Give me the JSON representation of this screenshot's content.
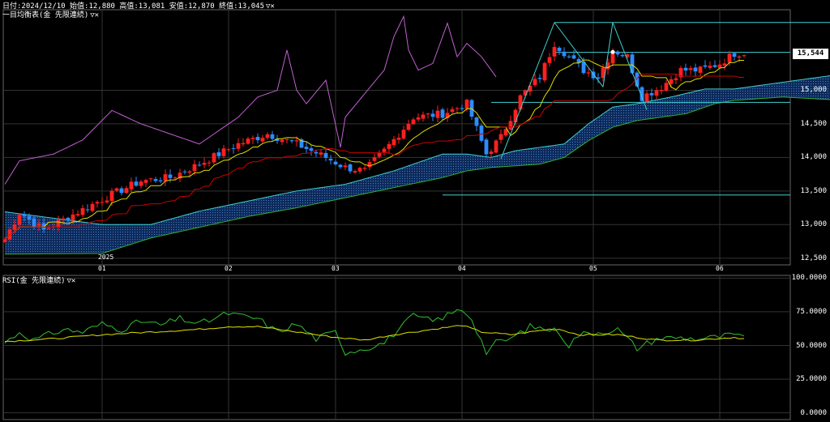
{
  "header": {
    "ohlc_text": "日付:2024/12/10 始值:12,880 高值:13,081 安值:12,870 終值:13,045",
    "main_indicator": "一目均衡表(金 先限連続)",
    "sub_indicator": "RSI(金 先限連続)",
    "control_glyphs": "▽✕"
  },
  "colors": {
    "background": "#000000",
    "candle_up": "#ff2020",
    "candle_down": "#2e8cff",
    "tenkan": "#e0e000",
    "kijun": "#cc0000",
    "chikou": "#c060d0",
    "kumo_edge": "#40d0d0",
    "kumo_fill": "#0d2a5c",
    "trendline": "#40d0d0",
    "rsi_fast": "#30c030",
    "rsi_slow": "#e0e000",
    "grid": "#333333",
    "axis_label": "#ffffff"
  },
  "chart_data": [
    {
      "type": "candlestick",
      "title": "一目均衡表(金 先限連続)",
      "y_ticks": [
        "15,000",
        "14,500",
        "14,000",
        "13,500",
        "13,000",
        "12,500"
      ],
      "y_tick_values": [
        15000,
        14500,
        14000,
        13500,
        13000,
        12500
      ],
      "ylim": [
        12400,
        16200
      ],
      "x_ticks": [
        "01",
        "02",
        "03",
        "04",
        "05",
        "06"
      ],
      "x_tick_index": [
        20,
        46,
        68,
        94,
        121,
        147
      ],
      "year_marker": "2025",
      "year_marker_index": 20,
      "n_bars": 153,
      "last_price": "15,544",
      "last_price_value": 15544,
      "horizontal_lines": [
        15565,
        14820,
        13440
      ],
      "trendlines": [
        {
          "from": [
            102,
            13980
          ],
          "to": [
            113,
            16010
          ]
        },
        {
          "from": [
            113,
            16010
          ],
          "to": [
            123,
            15050
          ]
        },
        {
          "from": [
            123,
            15050
          ],
          "to": [
            125,
            16010
          ]
        },
        {
          "from": [
            125,
            16010
          ],
          "to": [
            132,
            14710
          ]
        },
        {
          "from": [
            113,
            16010
          ],
          "to": [
            195,
            16010
          ]
        }
      ],
      "anchors": [
        [
          0,
          12780
        ],
        [
          3,
          13180
        ],
        [
          8,
          12920
        ],
        [
          14,
          13150
        ],
        [
          22,
          13450
        ],
        [
          28,
          13650
        ],
        [
          34,
          13700
        ],
        [
          40,
          13900
        ],
        [
          48,
          14200
        ],
        [
          54,
          14350
        ],
        [
          60,
          14200
        ],
        [
          66,
          14000
        ],
        [
          70,
          13850
        ],
        [
          74,
          13800
        ],
        [
          78,
          14100
        ],
        [
          84,
          14600
        ],
        [
          90,
          14650
        ],
        [
          95,
          14800
        ],
        [
          99,
          14050
        ],
        [
          102,
          14300
        ],
        [
          106,
          14900
        ],
        [
          110,
          15200
        ],
        [
          113,
          15700
        ],
        [
          116,
          15500
        ],
        [
          119,
          15300
        ],
        [
          122,
          15200
        ],
        [
          125,
          15600
        ],
        [
          128,
          15500
        ],
        [
          131,
          14900
        ],
        [
          135,
          15050
        ],
        [
          139,
          15300
        ],
        [
          143,
          15300
        ],
        [
          147,
          15400
        ],
        [
          150,
          15550
        ],
        [
          152,
          15560
        ]
      ],
      "kumo_upper_anchors": [
        [
          0,
          13190
        ],
        [
          20,
          13000
        ],
        [
          30,
          13000
        ],
        [
          40,
          13200
        ],
        [
          50,
          13350
        ],
        [
          60,
          13500
        ],
        [
          70,
          13600
        ],
        [
          80,
          13800
        ],
        [
          90,
          14050
        ],
        [
          95,
          14050
        ],
        [
          100,
          14000
        ],
        [
          105,
          14100
        ],
        [
          115,
          14200
        ],
        [
          120,
          14500
        ],
        [
          125,
          14750
        ],
        [
          130,
          14800
        ],
        [
          137,
          14900
        ],
        [
          144,
          15020
        ],
        [
          150,
          15020
        ],
        [
          160,
          15120
        ],
        [
          170,
          15220
        ],
        [
          180,
          15320
        ],
        [
          186,
          15380
        ]
      ],
      "kumo_lower_anchors": [
        [
          0,
          12560
        ],
        [
          20,
          12570
        ],
        [
          30,
          12800
        ],
        [
          40,
          12960
        ],
        [
          50,
          13120
        ],
        [
          60,
          13250
        ],
        [
          70,
          13400
        ],
        [
          80,
          13550
        ],
        [
          90,
          13700
        ],
        [
          95,
          13800
        ],
        [
          100,
          13850
        ],
        [
          110,
          13900
        ],
        [
          115,
          14000
        ],
        [
          120,
          14250
        ],
        [
          125,
          14450
        ],
        [
          130,
          14550
        ],
        [
          140,
          14650
        ],
        [
          146,
          14800
        ],
        [
          150,
          14850
        ],
        [
          160,
          14900
        ],
        [
          170,
          14860
        ],
        [
          180,
          14870
        ],
        [
          186,
          14870
        ]
      ],
      "chikou_anchors": [
        [
          0,
          13600
        ],
        [
          3,
          13950
        ],
        [
          10,
          14050
        ],
        [
          16,
          14260
        ],
        [
          22,
          14700
        ],
        [
          28,
          14500
        ],
        [
          32,
          14400
        ],
        [
          40,
          14200
        ],
        [
          48,
          14600
        ],
        [
          52,
          14900
        ],
        [
          56,
          15000
        ],
        [
          58,
          15600
        ],
        [
          60,
          15000
        ],
        [
          62,
          14800
        ],
        [
          66,
          15150
        ],
        [
          69,
          14150
        ],
        [
          70,
          14600
        ],
        [
          74,
          14950
        ],
        [
          78,
          15300
        ],
        [
          80,
          15800
        ],
        [
          82,
          16100
        ],
        [
          83,
          15600
        ],
        [
          85,
          15300
        ],
        [
          88,
          15400
        ],
        [
          91,
          16000
        ],
        [
          93,
          15500
        ],
        [
          95,
          15700
        ],
        [
          98,
          15500
        ],
        [
          101,
          15200
        ]
      ]
    },
    {
      "type": "line",
      "title": "RSI(金 先限連続)",
      "y_ticks": [
        "100.0000",
        "75.0000",
        "50.0000",
        "25.0000",
        "0.0000"
      ],
      "y_tick_values": [
        100,
        75,
        50,
        25,
        0
      ],
      "ylim": [
        -5,
        102
      ],
      "series": [
        {
          "values_anchors": [
            [
              0,
              52
            ],
            [
              3,
              60
            ],
            [
              6,
              54
            ],
            [
              9,
              58
            ],
            [
              12,
              62
            ],
            [
              16,
              60
            ],
            [
              20,
              66
            ],
            [
              24,
              62
            ],
            [
              28,
              68
            ],
            [
              32,
              65
            ],
            [
              36,
              70
            ],
            [
              40,
              66
            ],
            [
              46,
              74
            ],
            [
              48,
              72
            ],
            [
              52,
              70
            ],
            [
              56,
              60
            ],
            [
              60,
              66
            ],
            [
              64,
              55
            ],
            [
              68,
              60
            ],
            [
              70,
              45
            ],
            [
              74,
              48
            ],
            [
              78,
              52
            ],
            [
              84,
              72
            ],
            [
              88,
              68
            ],
            [
              92,
              74
            ],
            [
              94,
              77
            ],
            [
              96,
              70
            ],
            [
              99,
              45
            ],
            [
              101,
              52
            ],
            [
              104,
              55
            ],
            [
              108,
              64
            ],
            [
              112,
              62
            ],
            [
              114,
              60
            ],
            [
              116,
              50
            ],
            [
              118,
              58
            ],
            [
              122,
              60
            ],
            [
              126,
              62
            ],
            [
              130,
              48
            ],
            [
              134,
              55
            ],
            [
              138,
              56
            ],
            [
              142,
              55
            ],
            [
              146,
              56
            ],
            [
              150,
              58
            ],
            [
              152,
              55
            ]
          ]
        },
        {
          "values_anchors": [
            [
              0,
              53
            ],
            [
              10,
              55
            ],
            [
              20,
              58
            ],
            [
              30,
              60
            ],
            [
              40,
              62
            ],
            [
              46,
              64
            ],
            [
              52,
              64
            ],
            [
              60,
              60
            ],
            [
              68,
              56
            ],
            [
              74,
              54
            ],
            [
              80,
              58
            ],
            [
              88,
              62
            ],
            [
              94,
              65
            ],
            [
              98,
              60
            ],
            [
              104,
              58
            ],
            [
              112,
              62
            ],
            [
              114,
              62
            ],
            [
              118,
              58
            ],
            [
              126,
              58
            ],
            [
              134,
              54
            ],
            [
              142,
              54
            ],
            [
              150,
              56
            ],
            [
              152,
              55
            ]
          ]
        }
      ]
    }
  ]
}
